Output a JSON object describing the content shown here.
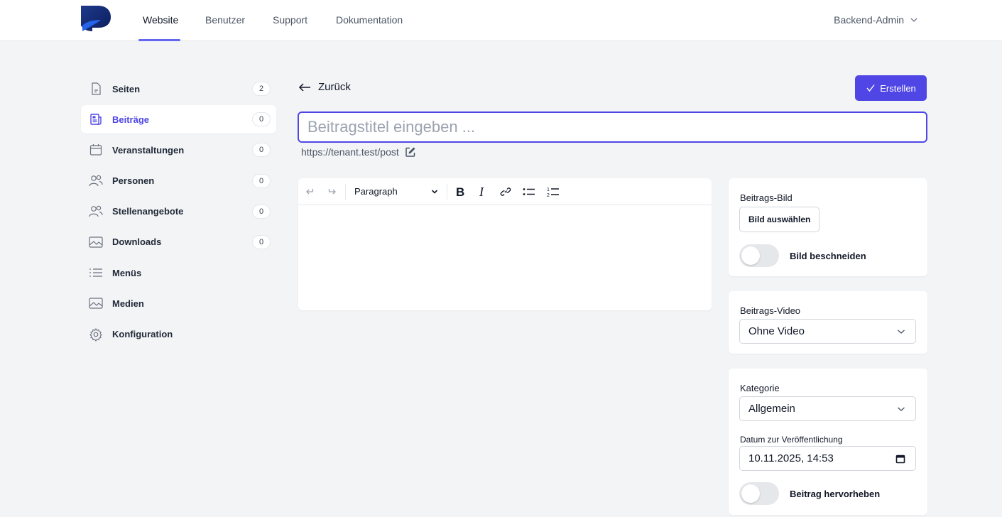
{
  "nav": {
    "items": [
      {
        "label": "Website",
        "active": true
      },
      {
        "label": "Benutzer",
        "active": false
      },
      {
        "label": "Support",
        "active": false
      },
      {
        "label": "Dokumentation",
        "active": false
      }
    ],
    "user": "Backend-Admin"
  },
  "sidebar": {
    "items": [
      {
        "label": "Seiten",
        "count": "2",
        "icon": "document-icon"
      },
      {
        "label": "Beiträge",
        "count": "0",
        "icon": "newspaper-icon",
        "active": true
      },
      {
        "label": "Veranstaltungen",
        "count": "0",
        "icon": "calendar-icon"
      },
      {
        "label": "Personen",
        "count": "0",
        "icon": "users-icon"
      },
      {
        "label": "Stellenangebote",
        "count": "0",
        "icon": "users-icon"
      },
      {
        "label": "Downloads",
        "count": "0",
        "icon": "image-icon"
      },
      {
        "label": "Menüs",
        "icon": "list-icon"
      },
      {
        "label": "Medien",
        "icon": "image-icon"
      },
      {
        "label": "Konfiguration",
        "icon": "gear-icon"
      }
    ]
  },
  "header": {
    "back_label": "Zurück",
    "create_label": "Erstellen"
  },
  "post": {
    "title_placeholder": "Beitragstitel eingeben ...",
    "title_value": "",
    "url": "https://tenant.test/post"
  },
  "editor": {
    "block_type": "Paragraph"
  },
  "image_card": {
    "label": "Beitrags-Bild",
    "button_label": "Bild auswählen",
    "crop_label": "Bild beschneiden",
    "crop_enabled": false
  },
  "video_card": {
    "label": "Beitrags-Video",
    "selected": "Ohne Video"
  },
  "category_card": {
    "label": "Kategorie",
    "selected": "Allgemein",
    "date_label": "Datum zur Veröffentlichung",
    "date_value": "10.11.2025, 14:53",
    "highlight_label": "Beitrag hervorheben",
    "highlight_enabled": false
  },
  "colors": {
    "accent": "#4f46e5",
    "background": "#f3f4f6"
  }
}
